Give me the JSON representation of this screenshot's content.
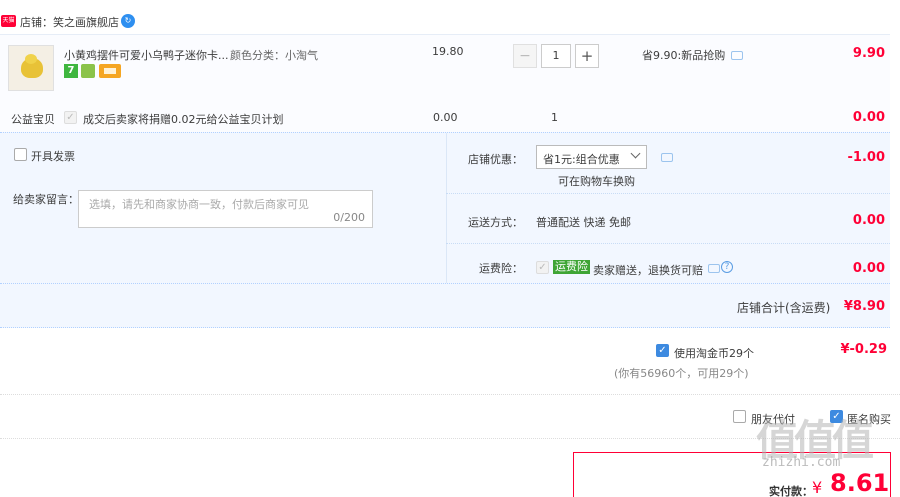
{
  "shop": {
    "badge": "天猫",
    "label": "店铺：笑之画旗舰店"
  },
  "item": {
    "title": "小黄鸡摆件可爱小乌鸭子迷你卡...",
    "spec": "颜色分类：小淘气",
    "price": "19.80",
    "quantity": "1",
    "minus": "−",
    "plus": "+",
    "promo": "省9.90:新品抢购",
    "subtotal": "9.90",
    "badge_7": "7"
  },
  "charity": {
    "label": "公益宝贝",
    "text": "成交后卖家将捐赠0.02元给公益宝贝计划",
    "price": "0.00",
    "qty": "1",
    "subtotal": "0.00"
  },
  "invoice": {
    "label": "开具发票"
  },
  "message": {
    "label": "给卖家留言：",
    "placeholder": "选填，请先和商家协商一致，付款后商家可见",
    "counter": "0/200"
  },
  "coupon": {
    "label": "店铺优惠：",
    "value": "省1元:组合优惠",
    "hint": "可在购物车换购",
    "amount": "-1.00"
  },
  "shipping": {
    "label": "运送方式：",
    "value": "普通配送 快递 免邮",
    "amount": "0.00"
  },
  "insurance": {
    "label": "运费险：",
    "badge": "运费险",
    "text": "卖家赠送，退换货可赔",
    "amount": "0.00"
  },
  "total": {
    "label": "店铺合计(含运费)",
    "amount": "¥8.90"
  },
  "coins": {
    "label": "使用淘金币29个",
    "detail": "(你有56960个，可用29个)",
    "amount": "¥-0.29"
  },
  "options": {
    "friend_pay": "朋友代付",
    "anonymous": "匿名购买"
  },
  "pay": {
    "label": "实付款：",
    "currency": "¥",
    "amount": "8.61"
  },
  "watermark": {
    "logo": "值值值",
    "url": "zhizhi.com"
  },
  "colors": {
    "accent_red": "#ff0036",
    "panel_blue": "#f2f7ff",
    "border_blue": "#b2d1ff",
    "check_blue": "#3d8ae0"
  }
}
